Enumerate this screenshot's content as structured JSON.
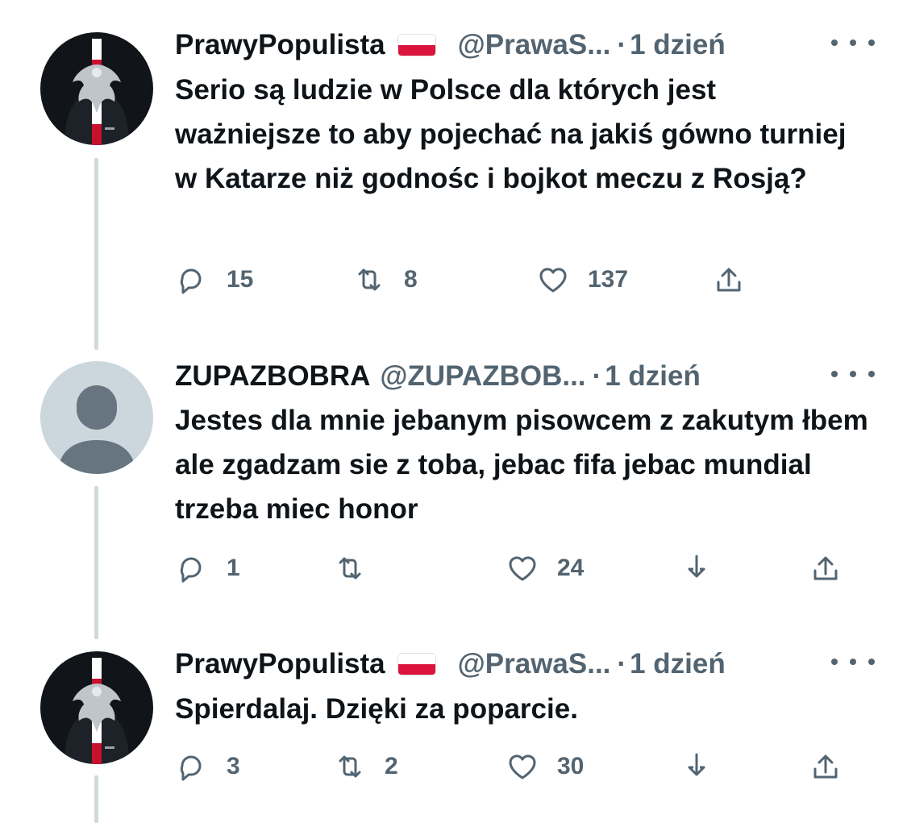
{
  "tweets": [
    {
      "name": "PrawyPopulista",
      "handle": "@PrawaS...",
      "dot": "·",
      "time": "1 dzień",
      "text": "Serio są ludzie w Polsce dla których jest ważniejsze to aby pojechać na jakiś gówno turniej w Katarze niż godnośc i bojkot meczu z Rosją?",
      "replies": "15",
      "retweets": "8",
      "likes": "137",
      "avatar_icon": "eagle-sweatshirt-avatar-icon"
    },
    {
      "name": "ZUPAZBOBRA",
      "handle": "@ZUPAZBOB...",
      "dot": "·",
      "time": "1 dzień",
      "text": "Jestes dla mnie jebanym pisowcem z zakutym łbem ale zgadzam sie z toba, jebac fifa jebac mundial trzeba miec honor",
      "replies": "1",
      "retweets": "",
      "likes": "24",
      "avatar_icon": "default-user-avatar-icon"
    },
    {
      "name": "PrawyPopulista",
      "handle": "@PrawaS...",
      "dot": "·",
      "time": "1 dzień",
      "text": "Spierdalaj. Dzięki za poparcie.",
      "replies": "3",
      "retweets": "2",
      "likes": "30",
      "avatar_icon": "eagle-sweatshirt-avatar-icon"
    }
  ],
  "colors": {
    "text": "#0f1419",
    "secondary": "#536471",
    "thread_line": "#cfd9de",
    "flag_red": "#dc143c"
  }
}
